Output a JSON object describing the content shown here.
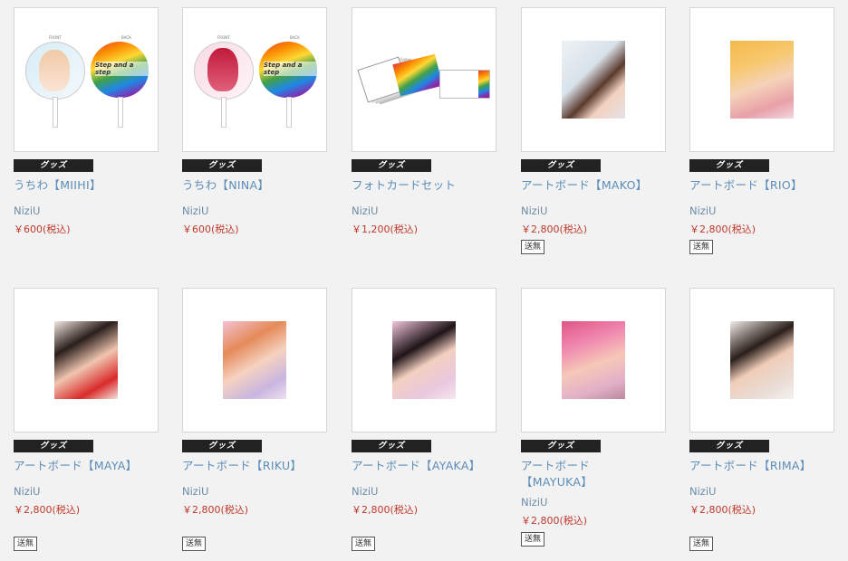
{
  "badge_label": "グッズ",
  "shipping_label": "送無",
  "fan_text": "Step and a step",
  "fan_front": "FRONT",
  "fan_back": "BACK",
  "products": [
    {
      "title": "うちわ【MIIHI】",
      "artist": "NiziU",
      "price": "￥600(税込)",
      "free_shipping": false
    },
    {
      "title": "うちわ【NINA】",
      "artist": "NiziU",
      "price": "￥600(税込)",
      "free_shipping": false
    },
    {
      "title": "フォトカードセット",
      "artist": "NiziU",
      "price": "￥1,200(税込)",
      "free_shipping": false
    },
    {
      "title": "アートボード【MAKO】",
      "artist": "NiziU",
      "price": "￥2,800(税込)",
      "free_shipping": true
    },
    {
      "title": "アートボード【RIO】",
      "artist": "NiziU",
      "price": "￥2,800(税込)",
      "free_shipping": true
    },
    {
      "title": "アートボード【MAYA】",
      "artist": "NiziU",
      "price": "￥2,800(税込)",
      "free_shipping": true
    },
    {
      "title": "アートボード【RIKU】",
      "artist": "NiziU",
      "price": "￥2,800(税込)",
      "free_shipping": true
    },
    {
      "title": "アートボード【AYAKA】",
      "artist": "NiziU",
      "price": "￥2,800(税込)",
      "free_shipping": true
    },
    {
      "title": "アートボード【MAYUKA】",
      "artist": "NiziU",
      "price": "￥2,800(税込)",
      "free_shipping": true
    },
    {
      "title": "アートボード【RIMA】",
      "artist": "NiziU",
      "price": "￥2,800(税込)",
      "free_shipping": true
    }
  ],
  "colors": {
    "badge": "#222222",
    "title": "#5b8db8",
    "price": "#c0392b",
    "background": "#f2f2f2"
  }
}
